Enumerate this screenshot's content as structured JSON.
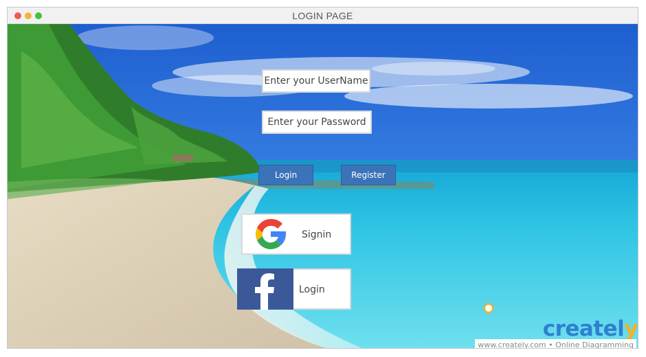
{
  "window": {
    "title": "LOGIN PAGE",
    "controls": [
      "close-dot",
      "minimize-dot",
      "maximize-dot"
    ]
  },
  "form": {
    "username_placeholder": "Enter your UserName",
    "password_placeholder": "Enter your Password",
    "login_label": "Login",
    "register_label": "Register"
  },
  "social": {
    "google_label": "Signin",
    "facebook_label": "Login"
  },
  "watermark": {
    "brand_prefix": "createl",
    "brand_suffix": "y",
    "tagline": "www.creately.com • Online Diagramming"
  },
  "colors": {
    "button": "#3b73b9",
    "facebook": "#3b5998",
    "brand_blue": "#2f7fd0",
    "brand_yellow": "#f3b124"
  }
}
